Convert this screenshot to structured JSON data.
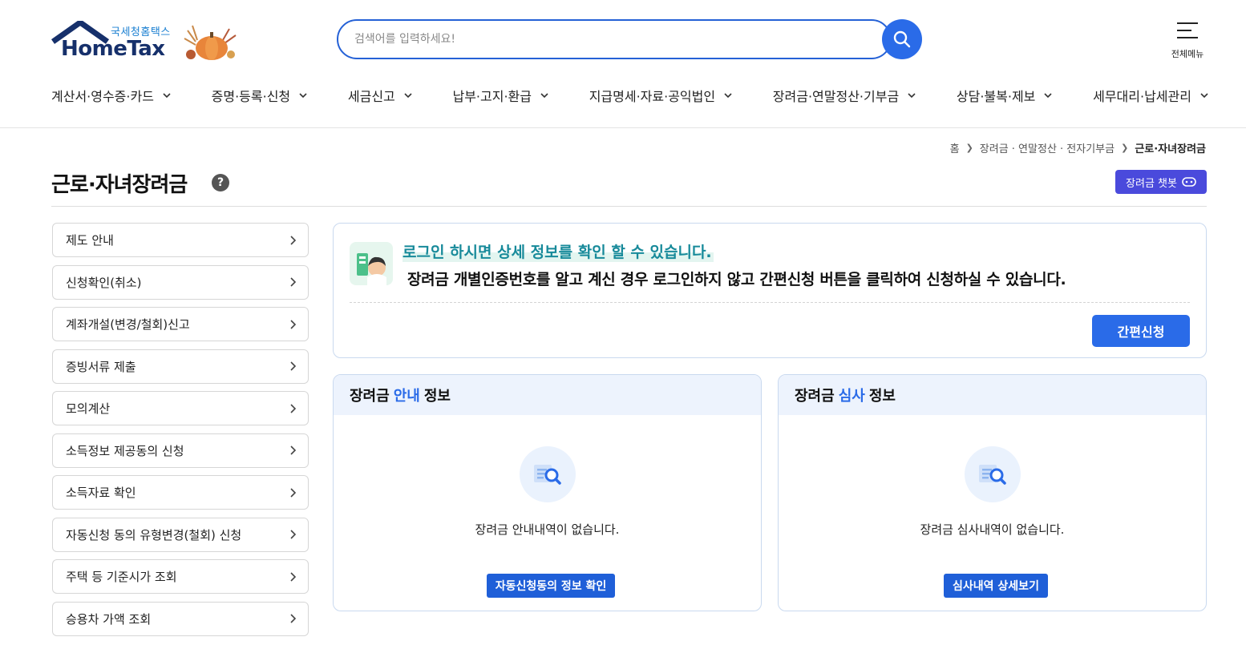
{
  "header": {
    "logo_sub": "국세청홈택스",
    "logo_main": "HomeTax",
    "search_placeholder": "검색어를 입력하세요!",
    "all_menu_label": "전체메뉴"
  },
  "gnb": [
    {
      "label": "계산서·영수증·카드"
    },
    {
      "label": "증명·등록·신청"
    },
    {
      "label": "세금신고"
    },
    {
      "label": "납부·고지·환급"
    },
    {
      "label": "지급명세·자료·공익법인"
    },
    {
      "label": "장려금·연말정산·기부금"
    },
    {
      "label": "상담·불복·제보"
    },
    {
      "label": "세무대리·납세관리"
    }
  ],
  "breadcrumb": {
    "home": "홈",
    "level1": "장려금 · 연말정산 · 전자기부금",
    "current": "근로·자녀장려금"
  },
  "page": {
    "title": "근로·자녀장려금",
    "help": "?",
    "chatbot_label": "장려금 챗봇"
  },
  "lnb": [
    {
      "label": "제도 안내"
    },
    {
      "label": "신청확인(취소)"
    },
    {
      "label": "계좌개설(변경/철회)신고"
    },
    {
      "label": "증빙서류 제출"
    },
    {
      "label": "모의계산"
    },
    {
      "label": "소득정보 제공동의 신청"
    },
    {
      "label": "소득자료 확인"
    },
    {
      "label": "자동신청 동의 유형변경(철회) 신청"
    },
    {
      "label": "주택 등 기준시가 조회"
    },
    {
      "label": "승용차 가액 조회"
    }
  ],
  "notice": {
    "headline": "로그인 하시면 상세 정보를 확인 할 수 있습니다.",
    "description": "장려금 개별인증번호를 알고 계신 경우 로그인하지 않고 간편신청 버튼을 클릭하여 신청하실 수 있습니다.",
    "easy_apply_label": "간편신청"
  },
  "panels": {
    "guide": {
      "title_pre": "장려금",
      "title_hl": "안내",
      "title_post": "정보",
      "empty_text": "장려금 안내내역이 없습니다.",
      "button_label": "자동신청동의 정보 확인"
    },
    "review": {
      "title_pre": "장려금",
      "title_hl": "심사",
      "title_post": "정보",
      "empty_text": "장려금 심사내역이 없습니다.",
      "button_label": "심사내역 상세보기"
    }
  },
  "colors": {
    "primary": "#2a6be8",
    "chatbot": "#4a4adc",
    "logo_navy": "#16306b",
    "notice_teal": "#178a9a"
  }
}
